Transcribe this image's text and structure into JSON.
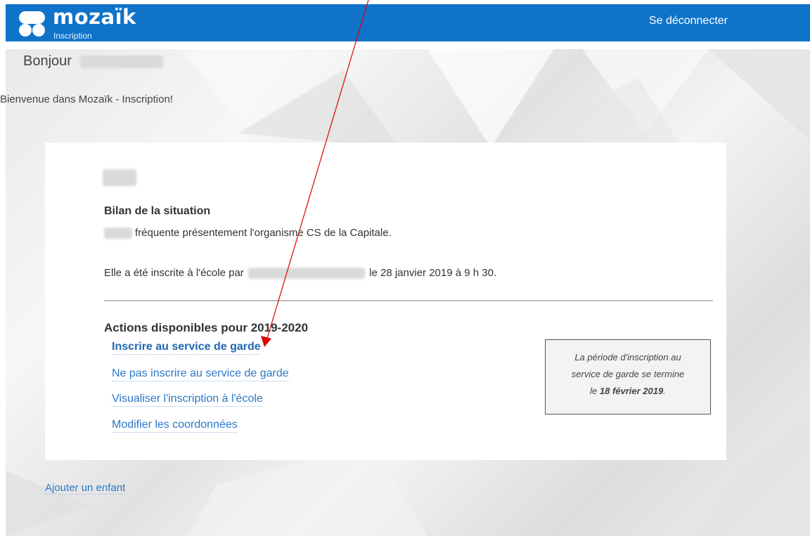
{
  "header": {
    "brand": "mozaïk",
    "brand_sub": "Inscription",
    "logout_label": "Se déconnecter",
    "bar_color": "#0f73c9"
  },
  "greeting": {
    "prefix": "Bonjour",
    "welcome": "Bienvenue dans Mozaïk - Inscription!"
  },
  "child_card": {
    "bilan_title": "Bilan de la situation",
    "status_line": "fréquente présentement l'organisme CS de la Capitale.",
    "registered_prefix": "Elle a été inscrite à l'école par",
    "registered_suffix": "le 28 janvier 2019 à 9 h 30.",
    "actions_title": "Actions disponibles pour 2019-2020",
    "actions": [
      {
        "label": "Inscrire au service de garde"
      },
      {
        "label": "Ne pas inscrire au service de garde"
      },
      {
        "label": "Visualiser l'inscription à l'école"
      },
      {
        "label": "Modifier les coordonnées"
      }
    ],
    "notice": {
      "line1": "La période d'inscription au",
      "line2": "service de garde se termine",
      "line3_prefix": "le",
      "date": "18 février 2019",
      "line3_suffix": "."
    }
  },
  "add_child_label": "Ajouter un enfant",
  "annotation_color": "#e00000",
  "link_color": "#2b78c8"
}
